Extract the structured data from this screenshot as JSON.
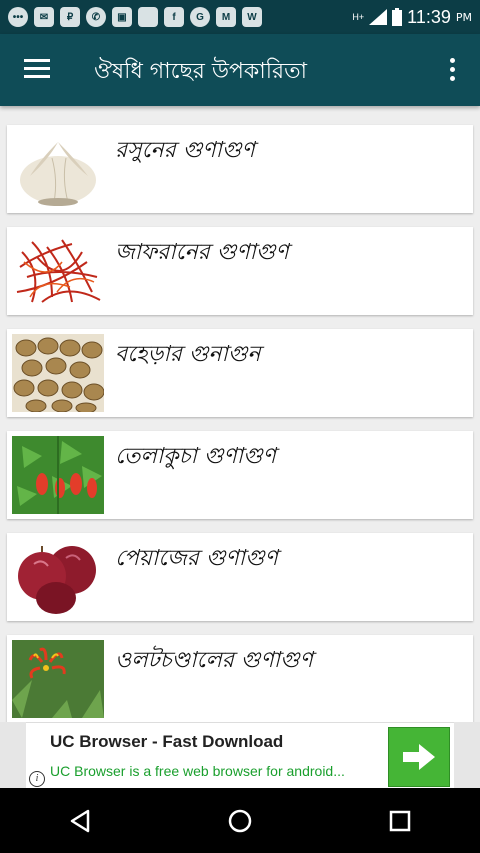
{
  "status_bar": {
    "time": "11:39",
    "ampm": "PM",
    "network": "H+",
    "icons": [
      "messaging-icon",
      "sms-icon",
      "paytm-icon",
      "whatsapp-icon",
      "gallery-icon",
      "app-icon",
      "facebook-icon",
      "g-icon",
      "gmail-icon",
      "app-icon",
      "signal-icon",
      "battery-icon"
    ]
  },
  "app_bar": {
    "title": "ঔষধি গাছের উপকারিতা"
  },
  "items": [
    {
      "title": "রসুনের গুণাগুণ",
      "icon": "garlic-image"
    },
    {
      "title": "জাফরানের গুণাগুণ",
      "icon": "saffron-image"
    },
    {
      "title": "বহেড়ার গুনাগুন",
      "icon": "bahera-seeds-image"
    },
    {
      "title": "তেলাকুচা গুণাগুণ",
      "icon": "telakucha-plant-image"
    },
    {
      "title": "পেয়াজের গুণাগুণ",
      "icon": "onion-image"
    },
    {
      "title": "ওলটচণ্ডালের গুণাগুণ",
      "icon": "gloriosa-flower-image"
    }
  ],
  "ad": {
    "title": "UC Browser - Fast Download",
    "text": "UC Browser is a free web browser for android...",
    "info_symbol": "i",
    "button_icon": "arrow-right-icon"
  },
  "nav_bar": {
    "buttons": [
      "back-icon",
      "home-icon",
      "recents-icon"
    ]
  }
}
